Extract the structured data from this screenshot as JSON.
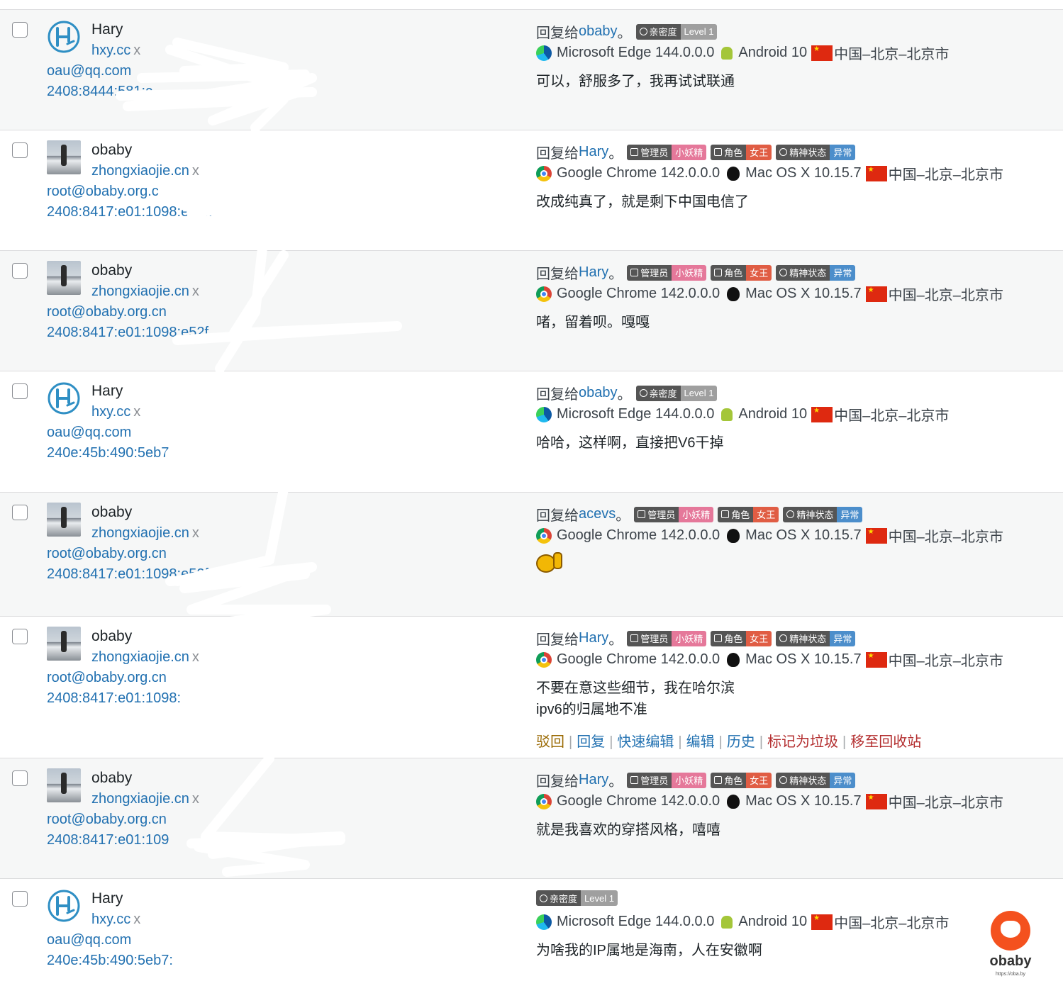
{
  "colors": {
    "link": "#2271b1",
    "approve": "#996800",
    "trash": "#b32d2e",
    "badge_left": "#555555",
    "pink": "#e5789a",
    "red": "#e05d44",
    "blue": "#4c8ecb",
    "gray": "#9f9f9f"
  },
  "comments": [
    {
      "author": "Hary",
      "url": "hxy.cc",
      "email": "oau@qq.com",
      "ip": "2408:8444:581:c",
      "avatar": "hary",
      "reply_prefix": "回复给 ",
      "reply_to": "obaby",
      "reply_suffix": "。",
      "badges": [
        {
          "icon": "heart",
          "left": "亲密度",
          "right": "Level 1",
          "color": "gray"
        }
      ],
      "browser": "Microsoft Edge 144.0.0.0",
      "browser_icon": "edge",
      "os": "Android 10",
      "os_icon": "android",
      "location": "中国–北京–北京市",
      "content": [
        "可以，舒服多了，我再试试联通"
      ]
    },
    {
      "author": "obaby",
      "url": "zhongxiaojie.cn",
      "email": "root@obaby.org.c",
      "ip": "2408:8417:e01:1098:e52f:",
      "avatar": "photo",
      "reply_prefix": "回复给 ",
      "reply_to": "Hary",
      "reply_suffix": "。",
      "badges": [
        {
          "icon": "terminal",
          "left": "管理员",
          "right": "小妖精",
          "color": "pink"
        },
        {
          "icon": "role",
          "left": "角色",
          "right": "女王",
          "color": "red"
        },
        {
          "icon": "pulse",
          "left": "精神状态",
          "right": "异常",
          "color": "blue"
        }
      ],
      "browser": "Google Chrome 142.0.0.0",
      "browser_icon": "chrome",
      "os": "Mac OS X 10.15.7",
      "os_icon": "apple",
      "location": "中国–北京–北京市",
      "content": [
        "改成纯真了，就是剩下中国电信了"
      ]
    },
    {
      "author": "obaby",
      "url": "zhongxiaojie.cn",
      "email": "root@obaby.org.cn",
      "ip": "2408:8417:e01:1098:e52f",
      "avatar": "photo",
      "reply_prefix": "回复给 ",
      "reply_to": "Hary",
      "reply_suffix": "。",
      "badges": [
        {
          "icon": "terminal",
          "left": "管理员",
          "right": "小妖精",
          "color": "pink"
        },
        {
          "icon": "role",
          "left": "角色",
          "right": "女王",
          "color": "red"
        },
        {
          "icon": "pulse",
          "left": "精神状态",
          "right": "异常",
          "color": "blue"
        }
      ],
      "browser": "Google Chrome 142.0.0.0",
      "browser_icon": "chrome",
      "os": "Mac OS X 10.15.7",
      "os_icon": "apple",
      "location": "中国–北京–北京市",
      "content": [
        "啫，留着呗。嘎嘎"
      ]
    },
    {
      "author": "Hary",
      "url": "hxy.cc",
      "email": "oau@qq.com",
      "ip": "240e:45b:490:5eb7:",
      "avatar": "hary",
      "reply_prefix": "回复给 ",
      "reply_to": "obaby",
      "reply_suffix": "。",
      "badges": [
        {
          "icon": "heart",
          "left": "亲密度",
          "right": "Level 1",
          "color": "gray"
        }
      ],
      "browser": "Microsoft Edge 144.0.0.0",
      "browser_icon": "edge",
      "os": "Android 10",
      "os_icon": "android",
      "location": "中国–北京–北京市",
      "content": [
        "哈哈，这样啊，直接把V6干掉"
      ]
    },
    {
      "author": "obaby",
      "url": "zhongxiaojie.cn",
      "email": "root@obaby.org.cn",
      "ip": "2408:8417:e01:1098:e52f",
      "avatar": "photo",
      "reply_prefix": "回复给 ",
      "reply_to": "acevs",
      "reply_suffix": "。",
      "badges": [
        {
          "icon": "terminal",
          "left": "管理员",
          "right": "小妖精",
          "color": "pink"
        },
        {
          "icon": "role",
          "left": "角色",
          "right": "女王",
          "color": "red"
        },
        {
          "icon": "pulse",
          "left": "精神状态",
          "right": "异常",
          "color": "blue"
        }
      ],
      "browser": "Google Chrome 142.0.0.0",
      "browser_icon": "chrome",
      "os": "Mac OS X 10.15.7",
      "os_icon": "apple",
      "location": "中国–北京–北京市",
      "content": [],
      "emoji": "thumbs-up-emoji"
    },
    {
      "author": "obaby",
      "url": "zhongxiaojie.cn",
      "email": "root@obaby.org.cn",
      "ip": "2408:8417:e01:1098:",
      "avatar": "photo",
      "reply_prefix": "回复给 ",
      "reply_to": "Hary",
      "reply_suffix": "。",
      "badges": [
        {
          "icon": "terminal",
          "left": "管理员",
          "right": "小妖精",
          "color": "pink"
        },
        {
          "icon": "role",
          "left": "角色",
          "right": "女王",
          "color": "red"
        },
        {
          "icon": "pulse",
          "left": "精神状态",
          "right": "异常",
          "color": "blue"
        }
      ],
      "browser": "Google Chrome 142.0.0.0",
      "browser_icon": "chrome",
      "os": "Mac OS X 10.15.7",
      "os_icon": "apple",
      "location": "中国–北京–北京市",
      "content": [
        "不要在意这些细节，我在哈尔滨",
        "ipv6的归属地不准"
      ],
      "actions": [
        {
          "label": "驳回",
          "color": "approve"
        },
        {
          "label": "回复",
          "color": "link"
        },
        {
          "label": "快速编辑",
          "color": "link"
        },
        {
          "label": "编辑",
          "color": "link"
        },
        {
          "label": "历史",
          "color": "link"
        },
        {
          "label": "标记为垃圾",
          "color": "trash"
        },
        {
          "label": "移至回收站",
          "color": "trash"
        }
      ]
    },
    {
      "author": "obaby",
      "url": "zhongxiaojie.cn",
      "email": "root@obaby.org.cn",
      "ip": "2408:8417:e01:109",
      "avatar": "photo",
      "reply_prefix": "回复给 ",
      "reply_to": "Hary",
      "reply_suffix": "。",
      "badges": [
        {
          "icon": "terminal",
          "left": "管理员",
          "right": "小妖精",
          "color": "pink"
        },
        {
          "icon": "role",
          "left": "角色",
          "right": "女王",
          "color": "red"
        },
        {
          "icon": "pulse",
          "left": "精神状态",
          "right": "异常",
          "color": "blue"
        }
      ],
      "browser": "Google Chrome 142.0.0.0",
      "browser_icon": "chrome",
      "os": "Mac OS X 10.15.7",
      "os_icon": "apple",
      "location": "中国–北京–北京市",
      "content": [
        "就是我喜欢的穿搭风格，嘻嘻"
      ]
    },
    {
      "author": "Hary",
      "url": "hxy.cc",
      "email": "oau@qq.com",
      "ip": "240e:45b:490:5eb7:",
      "avatar": "hary",
      "reply_prefix": "",
      "reply_to": "",
      "reply_suffix": "",
      "badges": [
        {
          "icon": "heart",
          "left": "亲密度",
          "right": "Level 1",
          "color": "gray"
        }
      ],
      "browser": "Microsoft Edge 144.0.0.0",
      "browser_icon": "edge",
      "os": "Android 10",
      "os_icon": "android",
      "location": "中国–北京–北京市",
      "content": [
        "为啥我的IP属地是海南，人在安徽啊"
      ]
    }
  ],
  "url_remove_mark": "x",
  "watermark": {
    "word": "obaby",
    "url": "https://oba.by"
  }
}
